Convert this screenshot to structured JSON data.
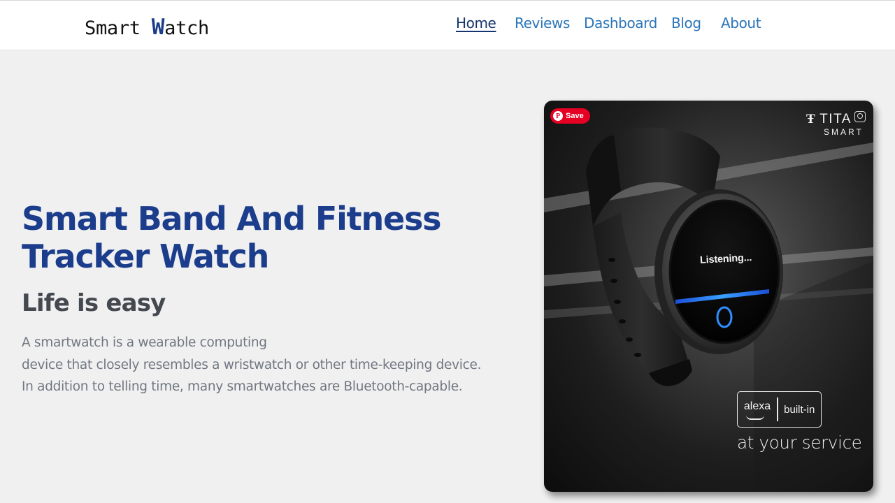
{
  "header": {
    "logo": {
      "prefix": "Smart ",
      "accent": "W",
      "suffix": "atch"
    },
    "nav": [
      {
        "label": "Home",
        "active": true
      },
      {
        "label": "Reviews",
        "active": false
      },
      {
        "label": "Dashboard",
        "active": false
      },
      {
        "label": "Blog",
        "active": false
      },
      {
        "label": "About",
        "active": false
      }
    ]
  },
  "hero": {
    "title": "Smart Band And Fitness Tracker Watch",
    "subtitle": "Life is easy",
    "description": [
      "A smartwatch is a wearable computing",
      "device that closely resembles a wristwatch or other time-keeping device.",
      "In addition to telling time, many smartwatches are Bluetooth-capable."
    ]
  },
  "product_image": {
    "save_label": "Save",
    "brand_name": "TITA",
    "brand_sub": "SMART",
    "watch_screen_text": "Listening...",
    "alexa_word": "alexa",
    "alexa_badge": "built-in",
    "tagline": "at your service"
  },
  "colors": {
    "brand_blue": "#1b3d8c",
    "nav_link": "#2a75b8",
    "nav_active": "#15346d",
    "subtitle": "#44494f",
    "body_text": "#717780",
    "page_bg": "#f0f0f1",
    "save_red": "#e60023",
    "alexa_blue": "#2f8fff"
  },
  "icons": {
    "save": "pinterest-icon",
    "lens": "visual-search-icon",
    "brand": "titan-logo-icon"
  }
}
